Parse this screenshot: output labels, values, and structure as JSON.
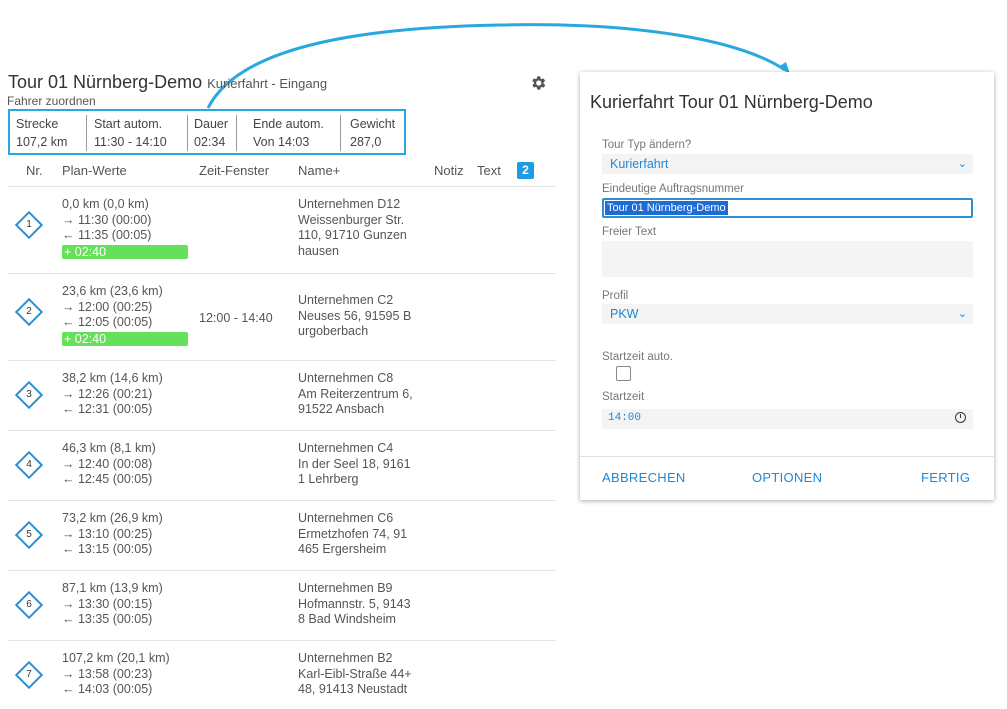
{
  "tour": {
    "title": "Tour 01 Nürnberg-Demo",
    "subtitle": "Kurierfahrt - Eingang",
    "assign_driver": "Fahrer zuordnen"
  },
  "summary": {
    "distance_label": "Strecke",
    "distance_value": "107,2 km",
    "start_label": "Start autom.",
    "start_value": "11:30 - 14:10",
    "duration_label": "Dauer",
    "duration_value": "02:34",
    "end_label": "Ende autom.",
    "end_value": "Von 14:03",
    "weight_label": "Gewicht",
    "weight_value": "287,0"
  },
  "table": {
    "headers": {
      "nr": "Nr.",
      "plan": "Plan-Werte",
      "window": "Zeit-Fenster",
      "name": "Name+",
      "note": "Notiz",
      "text": "Text",
      "badge": "2"
    },
    "rows": [
      {
        "nr": "1",
        "plan1": "0,0 km (0,0 km)",
        "plan2": "→ 11:30 (00:00)",
        "plan3": "← 11:35 (00:05)",
        "extra": "+ 02:40",
        "window": "",
        "name1": "Unternehmen D12",
        "name2": "Weissenburger Str.",
        "name3": "110, 91710 Gunzen",
        "name4": "hausen"
      },
      {
        "nr": "2",
        "plan1": "23,6 km (23,6 km)",
        "plan2": "→ 12:00 (00:25)",
        "plan3": "← 12:05 (00:05)",
        "extra": "+ 02:40",
        "window": "12:00 - 14:40",
        "name1": "Unternehmen C2",
        "name2": "Neuses 56, 91595 B",
        "name3": "urgoberbach",
        "name4": ""
      },
      {
        "nr": "3",
        "plan1": "38,2 km (14,6 km)",
        "plan2": "→ 12:26 (00:21)",
        "plan3": "← 12:31 (00:05)",
        "extra": "",
        "window": "",
        "name1": "Unternehmen C8",
        "name2": "Am Reiterzentrum 6,",
        "name3": "91522 Ansbach",
        "name4": ""
      },
      {
        "nr": "4",
        "plan1": "46,3 km (8,1 km)",
        "plan2": "→ 12:40 (00:08)",
        "plan3": "← 12:45 (00:05)",
        "extra": "",
        "window": "",
        "name1": "Unternehmen C4",
        "name2": "In der Seel 18, 9161",
        "name3": "1 Lehrberg",
        "name4": ""
      },
      {
        "nr": "5",
        "plan1": "73,2 km (26,9 km)",
        "plan2": "→ 13:10 (00:25)",
        "plan3": "← 13:15 (00:05)",
        "extra": "",
        "window": "",
        "name1": "Unternehmen C6",
        "name2": "Ermetzhofen 74, 91",
        "name3": "465 Ergersheim",
        "name4": ""
      },
      {
        "nr": "6",
        "plan1": "87,1 km (13,9 km)",
        "plan2": "→ 13:30 (00:15)",
        "plan3": "← 13:35 (00:05)",
        "extra": "",
        "window": "",
        "name1": "Unternehmen B9",
        "name2": "Hofmannstr. 5, 9143",
        "name3": "8 Bad Windsheim",
        "name4": ""
      },
      {
        "nr": "7",
        "plan1": "107,2 km (20,1 km)",
        "plan2": "→ 13:58 (00:23)",
        "plan3": "← 14:03 (00:05)",
        "extra": "",
        "window": "",
        "name1": "Unternehmen B2",
        "name2": "Karl-Eibl-Straße 44+",
        "name3": "48, 91413 Neustadt",
        "name4": ""
      }
    ]
  },
  "dialog": {
    "title": "Kurierfahrt Tour 01 Nürnberg-Demo",
    "tour_type_label": "Tour Typ ändern?",
    "tour_type_value": "Kurierfahrt",
    "order_label": "Eindeutige Auftragsnummer",
    "order_value": "Tour 01 Nürnberg-Demo",
    "free_text_label": "Freier Text",
    "profile_label": "Profil",
    "profile_value": "PKW",
    "start_auto_label": "Startzeit auto.",
    "start_auto_checked": false,
    "start_time_label": "Startzeit",
    "start_time_value": "14:00",
    "cancel": "ABBRECHEN",
    "options": "OPTIONEN",
    "done": "FERTIG"
  },
  "colors": {
    "accent": "#29a8df",
    "link": "#1e88d8",
    "highlight": "#66e05a"
  },
  "icons": {
    "settings": "gear-icon",
    "dropdown": "chevron-down-icon",
    "clock": "clock-icon",
    "stop": "diamond-icon"
  }
}
